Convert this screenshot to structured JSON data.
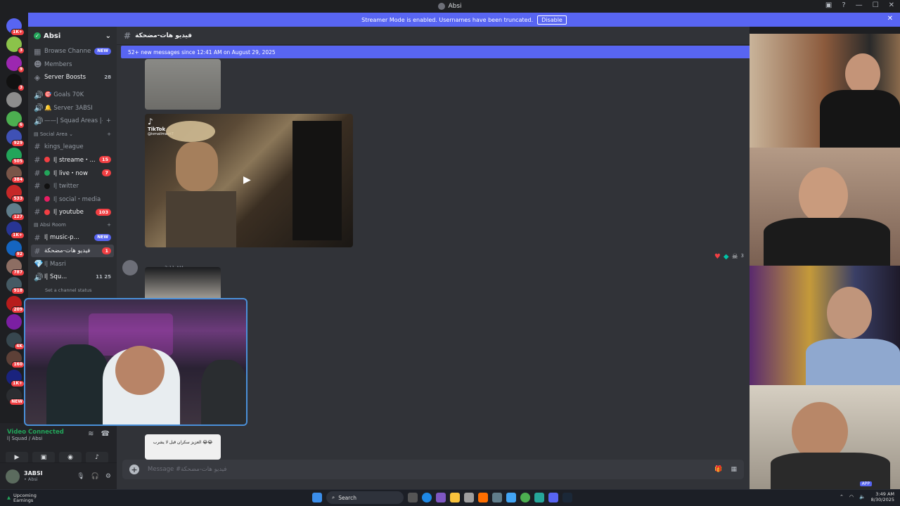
{
  "window": {
    "title": "Absi"
  },
  "banner": {
    "text": "Streamer Mode is enabled. Usernames have been truncated.",
    "disable_label": "Disable"
  },
  "guilds": [
    {
      "badge": "1K+",
      "color": "#5865f2"
    },
    {
      "badge": "3",
      "color": "#8bc34a"
    },
    {
      "badge": "9",
      "color": "#9c27b0"
    },
    {
      "badge": "3",
      "color": "#111111"
    },
    {
      "badge": "",
      "color": "#8d8d8d"
    },
    {
      "badge": "6",
      "color": "#4caf50"
    },
    {
      "badge": "929",
      "color": "#3f51b5"
    },
    {
      "badge": "505",
      "color": "#23a55a"
    },
    {
      "badge": "384",
      "color": "#795548"
    },
    {
      "badge": "533",
      "color": "#c62828"
    },
    {
      "badge": "127",
      "color": "#607d8b"
    },
    {
      "badge": "1K+",
      "color": "#283593"
    },
    {
      "badge": "92",
      "color": "#1565c0"
    },
    {
      "badge": "787",
      "color": "#8d6e63"
    },
    {
      "badge": "918",
      "color": "#455a64"
    },
    {
      "badge": "209",
      "color": "#b71c1c"
    },
    {
      "badge": "",
      "color": "#7b1fa2"
    },
    {
      "badge": "4K",
      "color": "#37474f"
    },
    {
      "badge": "160",
      "color": "#5d4037"
    },
    {
      "badge": "1K+",
      "color": "#1a237e"
    },
    {
      "badge": "NEW",
      "color": "#2b2d31"
    }
  ],
  "server": {
    "name": "Absi",
    "top_items": [
      {
        "label": "Browse Channels",
        "pill": "NEW"
      },
      {
        "label": "Members",
        "pill": ""
      },
      {
        "label": "Server Boosts",
        "pill": "28"
      }
    ],
    "channels": [
      {
        "label": "🎯 Goals 70K"
      },
      {
        "label": "🔔 Server 3ABSI"
      },
      {
        "label": "——| Squad Areas |—..."
      }
    ],
    "cat_social": "Social Area",
    "social_channels": [
      {
        "label": "kings_league",
        "pill": ""
      },
      {
        "label": "ا| streame・...",
        "pill": "15",
        "dot": "#f23f43"
      },
      {
        "label": "ا| live・now",
        "pill": "7",
        "dot": "#23a55a"
      },
      {
        "label": "ا| twitter",
        "pill": "",
        "dot": "#111111"
      },
      {
        "label": "ا| social・media",
        "pill": "",
        "dot": "#e91e63"
      },
      {
        "label": "ا| youtube",
        "pill": "103",
        "dot": "#f23f43"
      }
    ],
    "cat_room": "Absi Room",
    "room_channels": [
      {
        "label": "ا| music-p...",
        "pill": "NEW"
      },
      {
        "label": "فيديو هات-مضحكة",
        "pill": "1"
      },
      {
        "label": "ا| Masri",
        "pill": ""
      },
      {
        "label": "ا| Squ...",
        "pill": "11  25"
      }
    ],
    "channel_status": "Set a channel status"
  },
  "voice": {
    "status": "Video Connected",
    "sub": "ا| Squad / Absi"
  },
  "user": {
    "name": "3ABSI",
    "sub": "• Absi"
  },
  "chat": {
    "channel_name": "فيديو هات-مضحكة",
    "new_messages": "52+ new messages since 12:41 AM on August 29, 2025",
    "tiktok_label": "TikTok",
    "tiktok_handle": "@ismailmasri7",
    "message_time": "3:11 AM",
    "caption": "العزيز سكران قبل لا يشرب 😂😂",
    "placeholder": "Message #فيديو هات-مضحكة",
    "reaction_count": "3"
  },
  "cams": {
    "tag": "APP"
  },
  "taskbar": {
    "weather_title": "Upcoming",
    "weather_sub": "Earnings",
    "search": "Search",
    "time": "3:49 AM",
    "date": "8/30/2025"
  }
}
